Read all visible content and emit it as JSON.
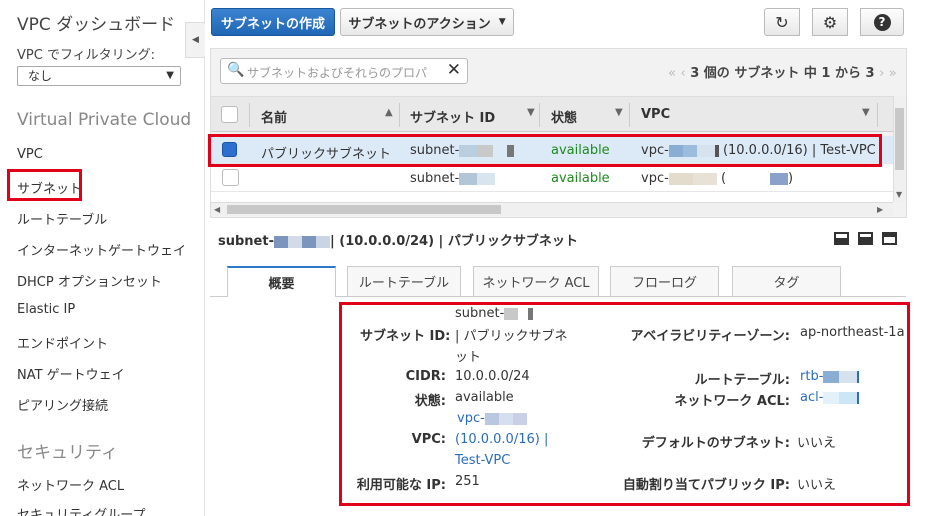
{
  "sidebar": {
    "title": "VPC ダッシュボード",
    "filter_label": "VPC でフィルタリング:",
    "filter_value": "なし",
    "section_vpc": "Virtual Private Cloud",
    "items_vpc": [
      "VPC",
      "サブネット",
      "ルートテーブル",
      "インターネットゲートウェイ",
      "DHCP オプションセット",
      "Elastic IP",
      "エンドポイント",
      "NAT ゲートウェイ",
      "ピアリング接続"
    ],
    "section_security": "セキュリティ",
    "items_security": [
      "ネットワーク ACL",
      "セキュリティグループ"
    ]
  },
  "toolbar": {
    "create_label": "サブネットの作成",
    "actions_label": "サブネットのアクション"
  },
  "search": {
    "placeholder": "サブネットおよびそれらのプロパ"
  },
  "pager": {
    "text": "3 個の サブネット 中 1 から 3"
  },
  "table": {
    "headers": [
      "名前",
      "サブネット ID",
      "状態",
      "VPC"
    ],
    "rows": [
      {
        "name": "パブリックサブネット",
        "subnet": "subnet-",
        "state": "available",
        "vpc": "vpc-",
        "vpc_suffix": "(10.0.0.0/16) | Test-VPC"
      },
      {
        "name": "",
        "subnet": "subnet-",
        "state": "available",
        "vpc": "vpc-",
        "vpc_suffix": "(",
        "vpc_end": ")"
      }
    ]
  },
  "detail": {
    "title_prefix": "subnet-",
    "title_suffix": "| (10.0.0.0/24) | パブリックサブネット",
    "tabs": [
      "概要",
      "ルートテーブル",
      "ネットワーク ACL",
      "フローログ",
      "タグ"
    ],
    "fields": {
      "subnet_id_label": "サブネット ID:",
      "subnet_id_line1": "subnet-",
      "subnet_id_line2": "| パブリックサブネ",
      "subnet_id_line3": "ット",
      "cidr_label": "CIDR:",
      "cidr_value": "10.0.0.0/24",
      "state_label": "状態:",
      "state_value": "available",
      "vpc_label": "VPC:",
      "vpc_line1": "vpc-",
      "vpc_line2": "(10.0.0.0/16) |",
      "vpc_line3": "Test-VPC",
      "ips_label": "利用可能な IP:",
      "ips_value": "251",
      "az_label": "アベイラビリティーゾーン:",
      "az_value": "ap-northeast-1a",
      "rt_label": "ルートテーブル:",
      "rt_value": "rtb-",
      "acl_label": "ネットワーク ACL:",
      "acl_value": "acl-",
      "default_label": "デフォルトのサブネット:",
      "default_value": "いいえ",
      "autoip_label": "自動割り当てパブリック IP:",
      "autoip_value": "いいえ"
    }
  },
  "colors": {
    "primary": "#1f66b4",
    "highlight": "#e0001a",
    "available": "#1e8a1e",
    "link": "#2a6dbb"
  }
}
